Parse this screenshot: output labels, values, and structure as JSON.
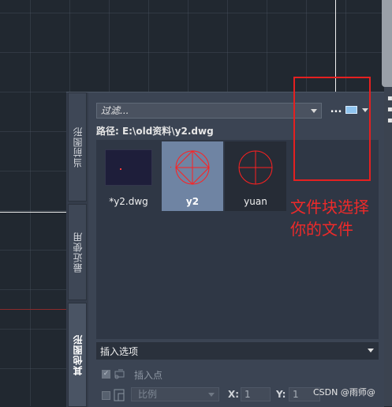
{
  "palette": {
    "tabs": [
      {
        "label": "当前图形",
        "active": false
      },
      {
        "label": "最近使用",
        "active": false
      },
      {
        "label": "其他图形",
        "active": true
      }
    ],
    "filter": {
      "placeholder": "过滤..."
    },
    "toolbar": {
      "more_label": "...",
      "view_icon": "thumbnail-view-icon"
    },
    "path_label": "路径: E:\\old资料\\y2.dwg",
    "blocks": [
      {
        "label": "*y2.dwg",
        "thumbnail": "drawing-preview",
        "selected": false
      },
      {
        "label": "y2",
        "thumbnail": "circle-diamond-cross-block",
        "selected": true
      },
      {
        "label": "yuan",
        "thumbnail": "circle-cross-block",
        "selected": false
      }
    ],
    "insert_options": {
      "header_label": "插入选项",
      "insert_point": {
        "label": "插入点",
        "checked": true,
        "enabled": false
      },
      "scale": {
        "checked": false,
        "combo_value": "比例",
        "x_label": "X:",
        "x_value": "1",
        "y_label": "Y:",
        "y_value": "1"
      }
    }
  },
  "annotation": {
    "line1": "文件块选择",
    "line2": "你的文件",
    "color": "#ee2a2a"
  },
  "watermark": "CSDN @雨师@",
  "colors": {
    "background": "#212830",
    "palette_bg": "#3b4453",
    "selected_tile": "#6f84a3",
    "block_stroke": "#ff2020"
  }
}
